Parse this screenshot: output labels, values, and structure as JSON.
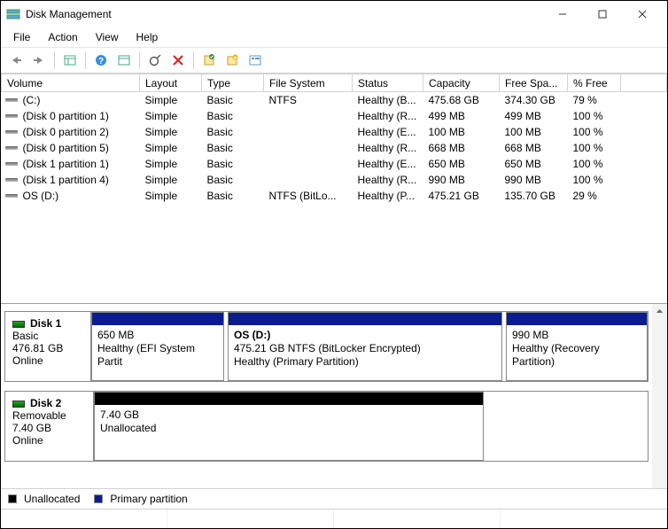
{
  "window": {
    "title": "Disk Management"
  },
  "menu": [
    "File",
    "Action",
    "View",
    "Help"
  ],
  "columns": [
    "Volume",
    "Layout",
    "Type",
    "File System",
    "Status",
    "Capacity",
    "Free Spa...",
    "% Free"
  ],
  "volumes": [
    {
      "name": "(C:)",
      "layout": "Simple",
      "type": "Basic",
      "fs": "NTFS",
      "status": "Healthy (B...",
      "cap": "475.68 GB",
      "free": "374.30 GB",
      "pct": "79 %"
    },
    {
      "name": "(Disk 0 partition 1)",
      "layout": "Simple",
      "type": "Basic",
      "fs": "",
      "status": "Healthy (R...",
      "cap": "499 MB",
      "free": "499 MB",
      "pct": "100 %"
    },
    {
      "name": "(Disk 0 partition 2)",
      "layout": "Simple",
      "type": "Basic",
      "fs": "",
      "status": "Healthy (E...",
      "cap": "100 MB",
      "free": "100 MB",
      "pct": "100 %"
    },
    {
      "name": "(Disk 0 partition 5)",
      "layout": "Simple",
      "type": "Basic",
      "fs": "",
      "status": "Healthy (R...",
      "cap": "668 MB",
      "free": "668 MB",
      "pct": "100 %"
    },
    {
      "name": "(Disk 1 partition 1)",
      "layout": "Simple",
      "type": "Basic",
      "fs": "",
      "status": "Healthy (E...",
      "cap": "650 MB",
      "free": "650 MB",
      "pct": "100 %"
    },
    {
      "name": "(Disk 1 partition 4)",
      "layout": "Simple",
      "type": "Basic",
      "fs": "",
      "status": "Healthy (R...",
      "cap": "990 MB",
      "free": "990 MB",
      "pct": "100 %"
    },
    {
      "name": "OS (D:)",
      "layout": "Simple",
      "type": "Basic",
      "fs": "NTFS (BitLo...",
      "status": "Healthy (P...",
      "cap": "475.21 GB",
      "free": "135.70 GB",
      "pct": "29 %"
    }
  ],
  "disks": [
    {
      "name": "Disk 1",
      "type": "Basic",
      "size": "476.81 GB",
      "status": "Online",
      "parts": [
        {
          "title": "",
          "l1": "650 MB",
          "l2": "Healthy (EFI System Partit",
          "bar": "#0b1d8c",
          "flex": 150
        },
        {
          "title": "OS  (D:)",
          "l1": "475.21 GB NTFS (BitLocker Encrypted)",
          "l2": "Healthy (Primary Partition)",
          "bar": "#0b1d8c",
          "flex": 310,
          "bold": true
        },
        {
          "title": "",
          "l1": "990 MB",
          "l2": "Healthy (Recovery Partition)",
          "bar": "#0b1d8c",
          "flex": 160
        }
      ]
    },
    {
      "name": "Disk 2",
      "type": "Removable",
      "size": "7.40 GB",
      "status": "Online",
      "parts": [
        {
          "title": "",
          "l1": "7.40 GB",
          "l2": "Unallocated",
          "bar": "#000000",
          "flex": 440
        }
      ]
    }
  ],
  "legend": {
    "unalloc": "Unallocated",
    "primary": "Primary partition"
  },
  "colors": {
    "primary": "#0b1d8c",
    "unalloc": "#000000"
  }
}
